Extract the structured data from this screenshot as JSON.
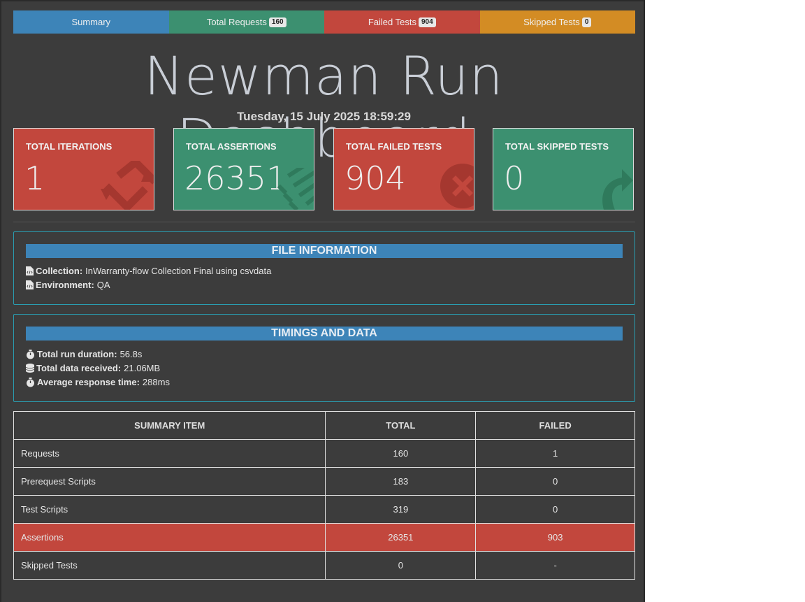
{
  "tabs": [
    {
      "label": "Summary",
      "badge": null,
      "color": "#3d84b8"
    },
    {
      "label": "Total Requests",
      "badge": "160",
      "color": "#3c9070"
    },
    {
      "label": "Failed Tests",
      "badge": "904",
      "color": "#c2473d"
    },
    {
      "label": "Skipped Tests",
      "badge": "0",
      "color": "#d38c24"
    }
  ],
  "header": {
    "title": "Newman Run Dashboard",
    "date": "Tuesday, 15 July 2025 18:59:29"
  },
  "cards": [
    {
      "label": "TOTAL ITERATIONS",
      "value": "1",
      "color": "#c2473d",
      "icon": "refresh-icon"
    },
    {
      "label": "TOTAL ASSERTIONS",
      "value": "26351",
      "color": "#3c9070",
      "icon": "list-check-icon"
    },
    {
      "label": "TOTAL FAILED TESTS",
      "value": "904",
      "color": "#c2473d",
      "icon": "times-circle-icon"
    },
    {
      "label": "TOTAL SKIPPED TESTS",
      "value": "0",
      "color": "#3c9070",
      "icon": "share-arrow-icon"
    }
  ],
  "file_info": {
    "heading": "FILE INFORMATION",
    "collection_label": "Collection:",
    "collection_value": "InWarranty-flow Collection Final using csvdata",
    "environment_label": "Environment:",
    "environment_value": "QA"
  },
  "timings": {
    "heading": "TIMINGS AND DATA",
    "duration_label": "Total run duration:",
    "duration_value": "56.8s",
    "data_label": "Total data received:",
    "data_value": "21.06MB",
    "response_label": "Average response time:",
    "response_value": "288ms"
  },
  "summary_table": {
    "headers": [
      "SUMMARY ITEM",
      "TOTAL",
      "FAILED"
    ],
    "rows": [
      {
        "item": "Requests",
        "total": "160",
        "failed": "1",
        "danger": false
      },
      {
        "item": "Prerequest Scripts",
        "total": "183",
        "failed": "0",
        "danger": false
      },
      {
        "item": "Test Scripts",
        "total": "319",
        "failed": "0",
        "danger": false
      },
      {
        "item": "Assertions",
        "total": "26351",
        "failed": "903",
        "danger": true
      },
      {
        "item": "Skipped Tests",
        "total": "0",
        "failed": "-",
        "danger": false
      }
    ]
  }
}
